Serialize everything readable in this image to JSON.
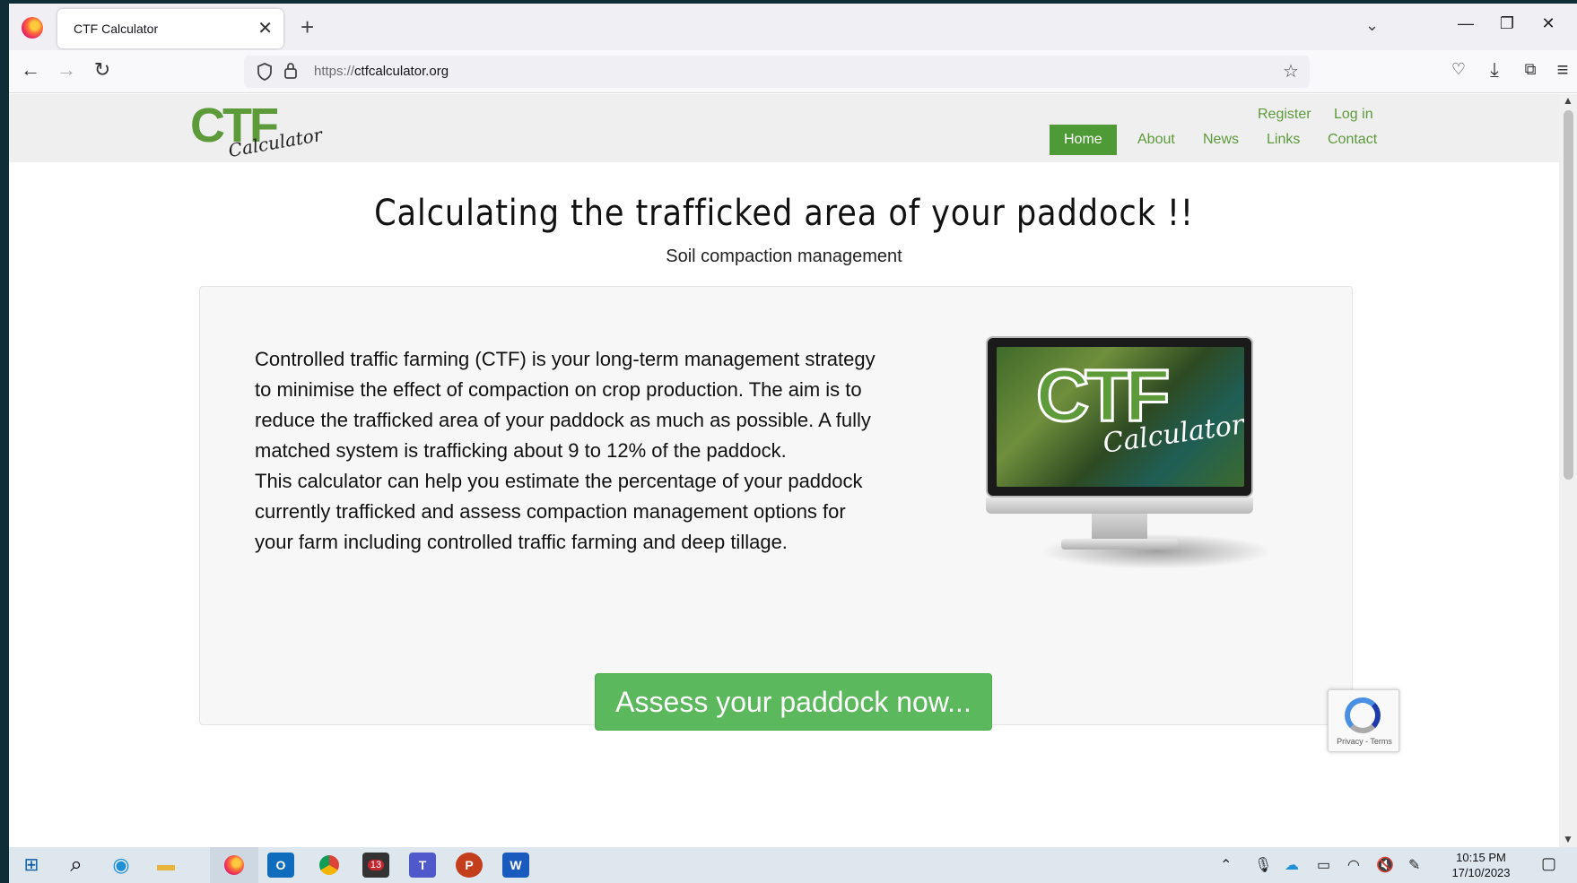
{
  "browser": {
    "tab_title": "CTF Calculator",
    "tab_close": "✕",
    "new_tab": "+",
    "url_protocol": "https://",
    "url_host": "ctfcalculator.org",
    "icons": [
      "firefox-icon",
      "back-icon",
      "forward-icon",
      "reload-icon",
      "shield-icon",
      "lock-icon",
      "bookmark-star-icon",
      "pocket-icon",
      "download-icon",
      "extensions-icon",
      "menu-icon",
      "list-all-tabs-icon",
      "minimize-icon",
      "restore-icon",
      "close-window-icon"
    ]
  },
  "site": {
    "logo_main": "CTF",
    "logo_sub": "Calculator",
    "util_links": {
      "register": "Register",
      "login": "Log in"
    },
    "menu": [
      "Home",
      "About",
      "News",
      "Links",
      "Contact"
    ],
    "active_menu": "Home",
    "accent_color": "#4e9a36",
    "button_color": "#5cb85c"
  },
  "hero": {
    "title": "Calculating the trafficked area of your paddock !!",
    "subtitle": "Soil compaction management"
  },
  "intro": {
    "paragraph1": "Controlled traffic farming (CTF) is your long-term management strategy to minimise the effect of compaction on crop production. The aim is to reduce the trafficked area of your paddock as much as possible. A fully matched system is trafficking about 9 to 12% of the paddock.",
    "paragraph2": "This calculator can help you estimate the percentage of your paddock currently trafficked and assess compaction management options for your farm including controlled traffic farming and deep tillage."
  },
  "monitor_image": {
    "logo_main": "CTF",
    "logo_sub": "Calculator"
  },
  "cta": {
    "label": "Assess your paddock now..."
  },
  "recaptcha": {
    "text": "Privacy - Terms"
  },
  "taskbar": {
    "apps": [
      "windows-start-icon",
      "search-icon",
      "edge-icon",
      "file-explorer-icon",
      "firefox-icon",
      "outlook-icon",
      "chrome-icon",
      "teams-badge-icon",
      "teams-icon",
      "powerpoint-icon",
      "word-icon"
    ],
    "badge_count": "13",
    "time": "10:15 PM",
    "date": "17/10/2023"
  }
}
